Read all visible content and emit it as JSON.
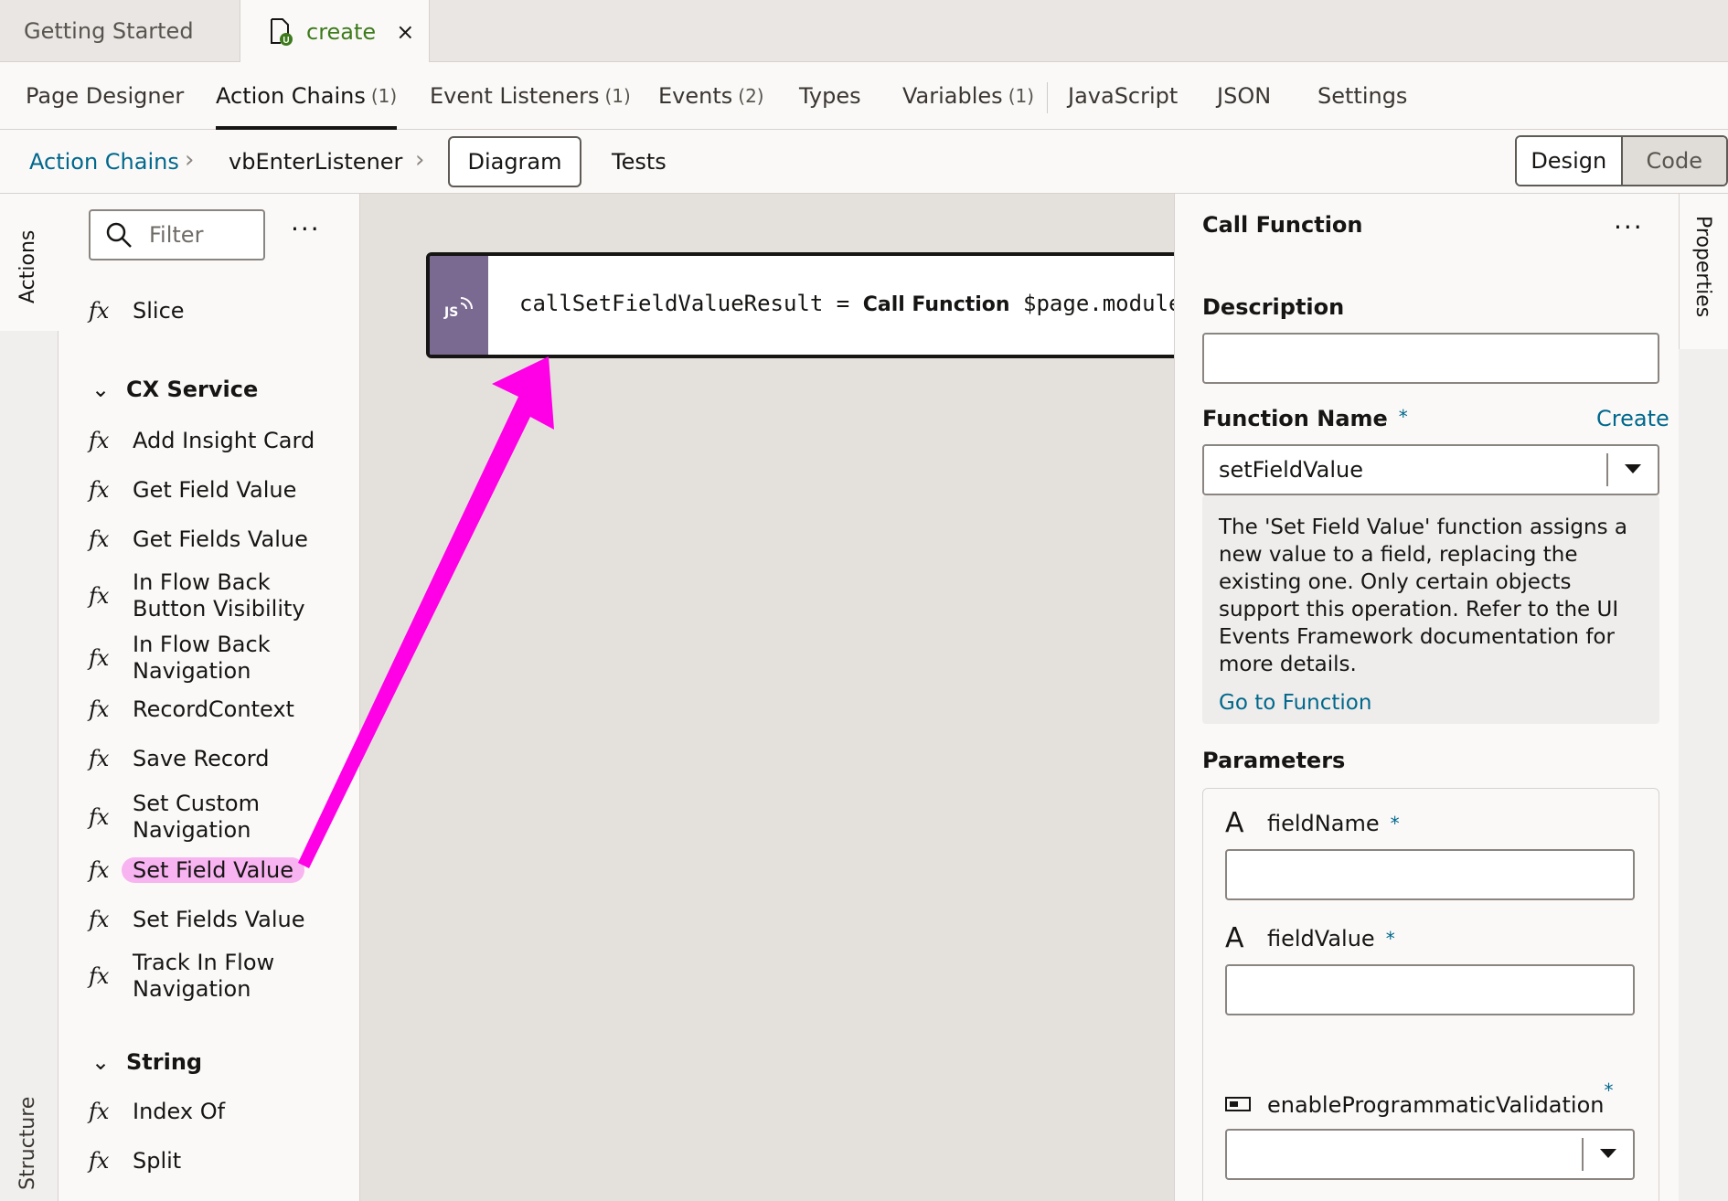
{
  "file_tabs": [
    {
      "label": "Getting Started"
    },
    {
      "label": "create",
      "close": "×"
    }
  ],
  "editor_tabs": [
    {
      "label": "Page Designer",
      "count": ""
    },
    {
      "label": "Action Chains",
      "count": "(1)"
    },
    {
      "label": "Event Listeners",
      "count": "(1)"
    },
    {
      "label": "Events",
      "count": "(2)"
    },
    {
      "label": "Types",
      "count": ""
    },
    {
      "label": "Variables",
      "count": "(1)"
    },
    {
      "label": "JavaScript",
      "count": ""
    },
    {
      "label": "JSON",
      "count": ""
    },
    {
      "label": "Settings",
      "count": ""
    }
  ],
  "breadcrumb": {
    "root": "Action Chains",
    "chain": "vbEnterListener",
    "diagram": "Diagram",
    "tests": "Tests",
    "design": "Design",
    "code": "Code"
  },
  "left_rail": {
    "actions": "Actions",
    "structure": "Structure"
  },
  "palette": {
    "filter_placeholder": "Filter",
    "more": "···",
    "items_top": [
      {
        "label": "Slice"
      }
    ],
    "groups": [
      {
        "title": "CX Service",
        "items": [
          {
            "label": "Add Insight Card"
          },
          {
            "label": "Get Field Value"
          },
          {
            "label": "Get Fields Value"
          },
          {
            "label": "In Flow Back Button Visibility"
          },
          {
            "label": "In Flow Back Navigation"
          },
          {
            "label": "RecordContext"
          },
          {
            "label": "Save Record"
          },
          {
            "label": "Set Custom Navigation"
          },
          {
            "label": "Set Field Value"
          },
          {
            "label": "Set Fields Value"
          },
          {
            "label": "Track In Flow Navigation"
          }
        ]
      },
      {
        "title": "String",
        "items": [
          {
            "label": "Index Of"
          },
          {
            "label": "Split"
          }
        ]
      }
    ],
    "fx": "fx"
  },
  "node": {
    "result": "callSetFieldValueResult",
    "op": "=",
    "action": "Call Function",
    "target": "$page.modules",
    "badge": "JS"
  },
  "properties": {
    "title": "Call Function",
    "more": "···",
    "description_label": "Description",
    "function_name_label": "Function Name",
    "required_mark": "*",
    "create_link": "Create",
    "function_value": "setFieldValue",
    "function_description": "The 'Set Field Value' function assigns a new value to a field, replacing the existing one. Only certain objects support this operation. Refer to the UI Events Framework documentation for more details.",
    "go_to_function": "Go to Function",
    "parameters_label": "Parameters",
    "params": [
      {
        "name": "fieldName",
        "icon": "A"
      },
      {
        "name": "fieldValue",
        "icon": "A"
      },
      {
        "name": "enableProgrammaticValidation",
        "icon": "boolean-icon"
      }
    ],
    "rail_label": "Properties"
  },
  "colors": {
    "accent": "#00688c",
    "green": "#3e7b1c",
    "annotation": "#ff00e6",
    "js_node": "#7a6991"
  }
}
